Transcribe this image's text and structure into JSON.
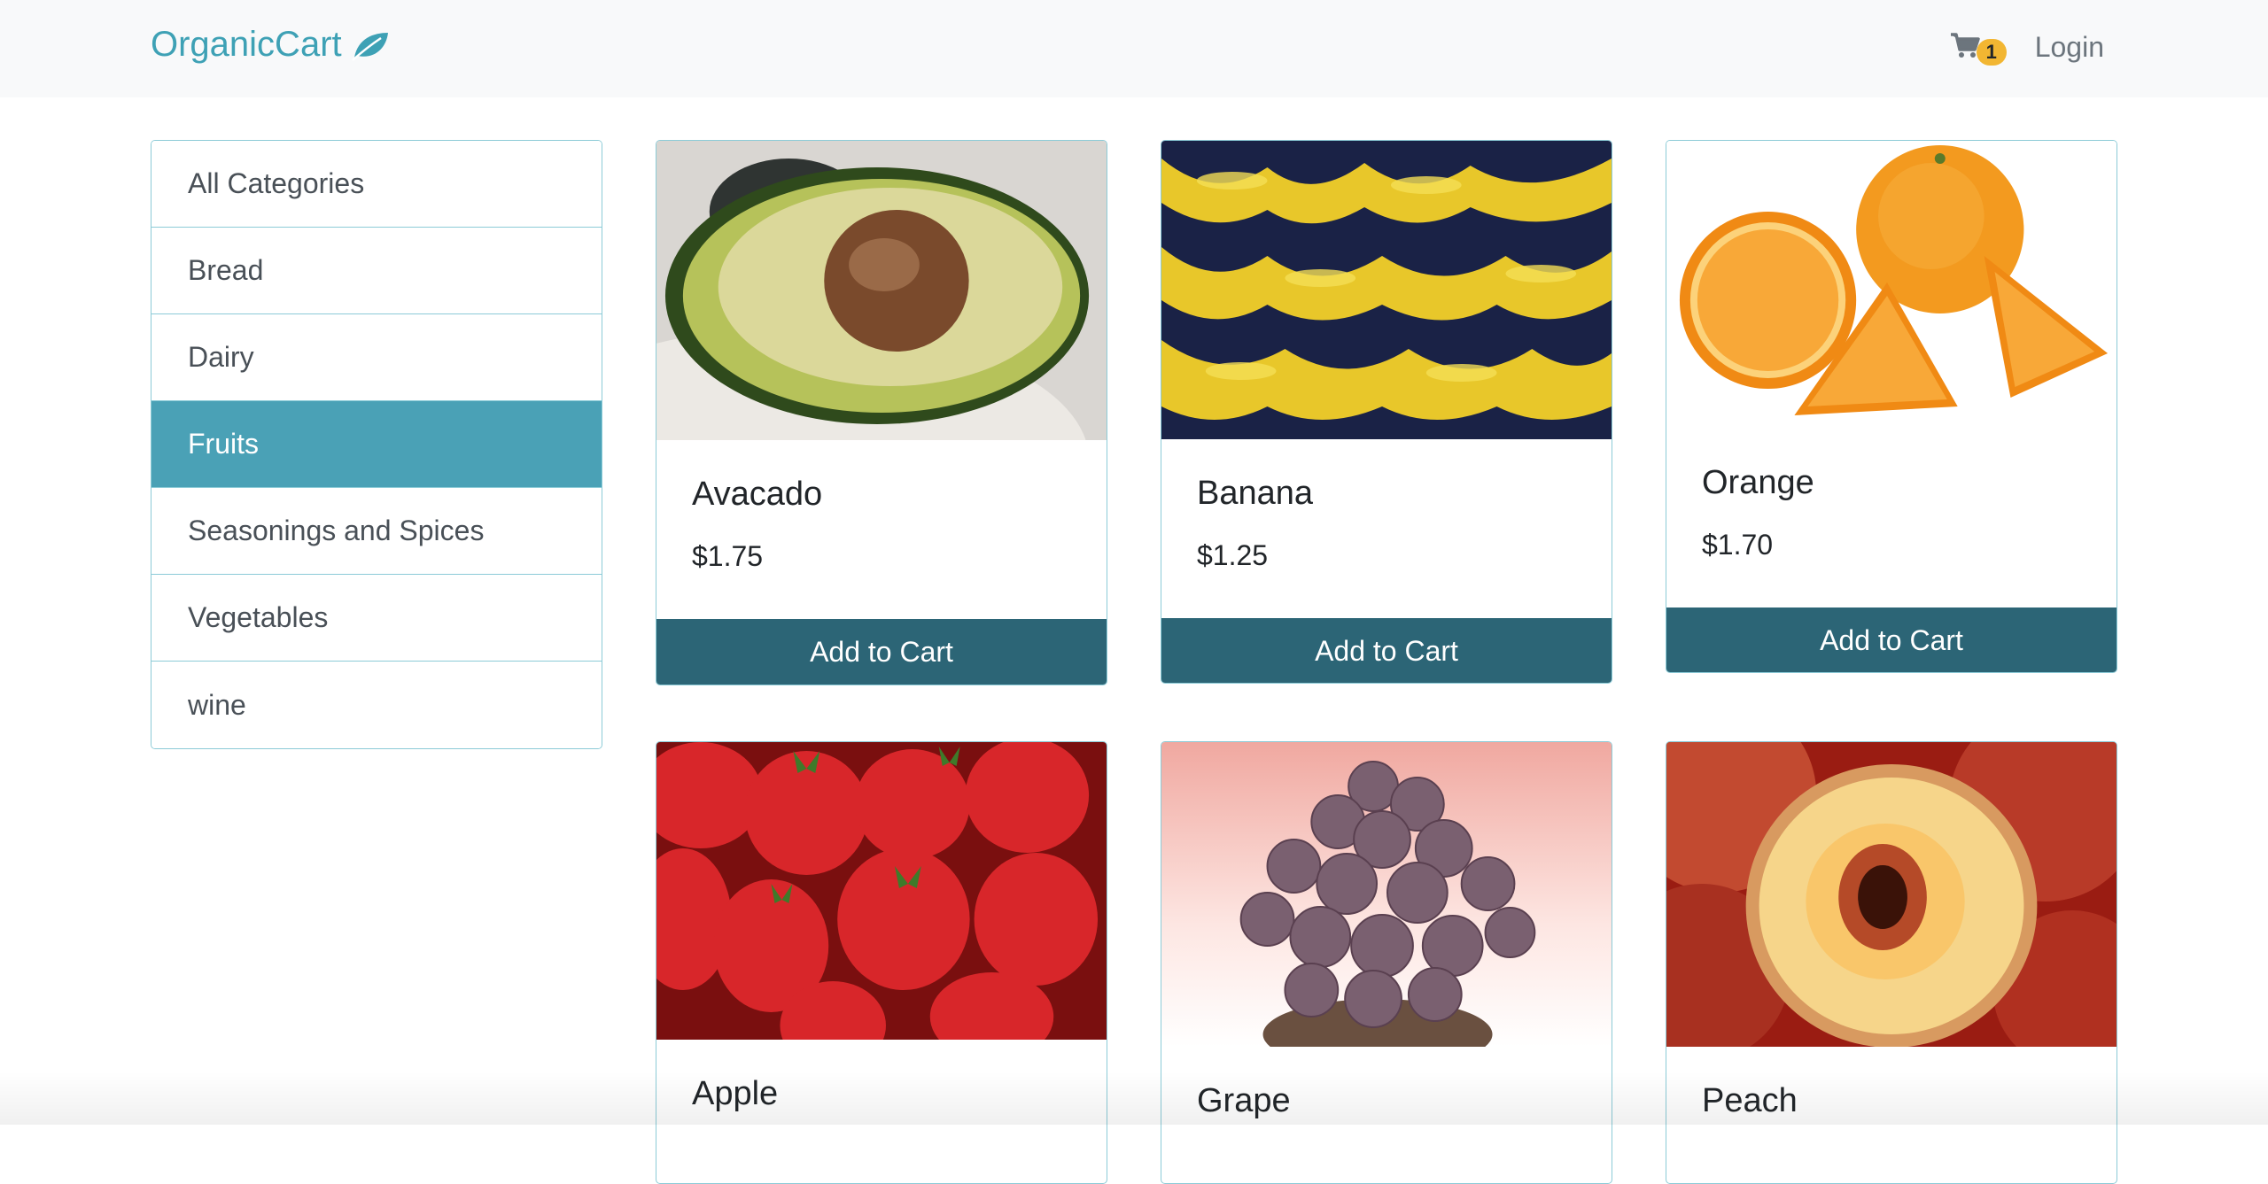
{
  "navbar": {
    "brand": "OrganicCart",
    "cart_count": "1",
    "login_label": "Login"
  },
  "sidebar": {
    "items": [
      {
        "label": "All Categories"
      },
      {
        "label": "Bread"
      },
      {
        "label": "Dairy"
      },
      {
        "label": "Fruits"
      },
      {
        "label": "Seasonings and Spices"
      },
      {
        "label": "Vegetables"
      },
      {
        "label": "wine"
      }
    ],
    "active": "Fruits"
  },
  "products": [
    {
      "name": "Avacado",
      "price": "$1.75",
      "button": "Add to Cart"
    },
    {
      "name": "Banana",
      "price": "$1.25",
      "button": "Add to Cart"
    },
    {
      "name": "Orange",
      "price": "$1.70",
      "button": "Add to Cart"
    },
    {
      "name": "Apple"
    },
    {
      "name": "Grape"
    },
    {
      "name": "Peach"
    }
  ],
  "colors": {
    "brand": "#3ea1b5",
    "active_category": "#4aa1b6",
    "button": "#2c6576",
    "badge": "#f2b632"
  }
}
